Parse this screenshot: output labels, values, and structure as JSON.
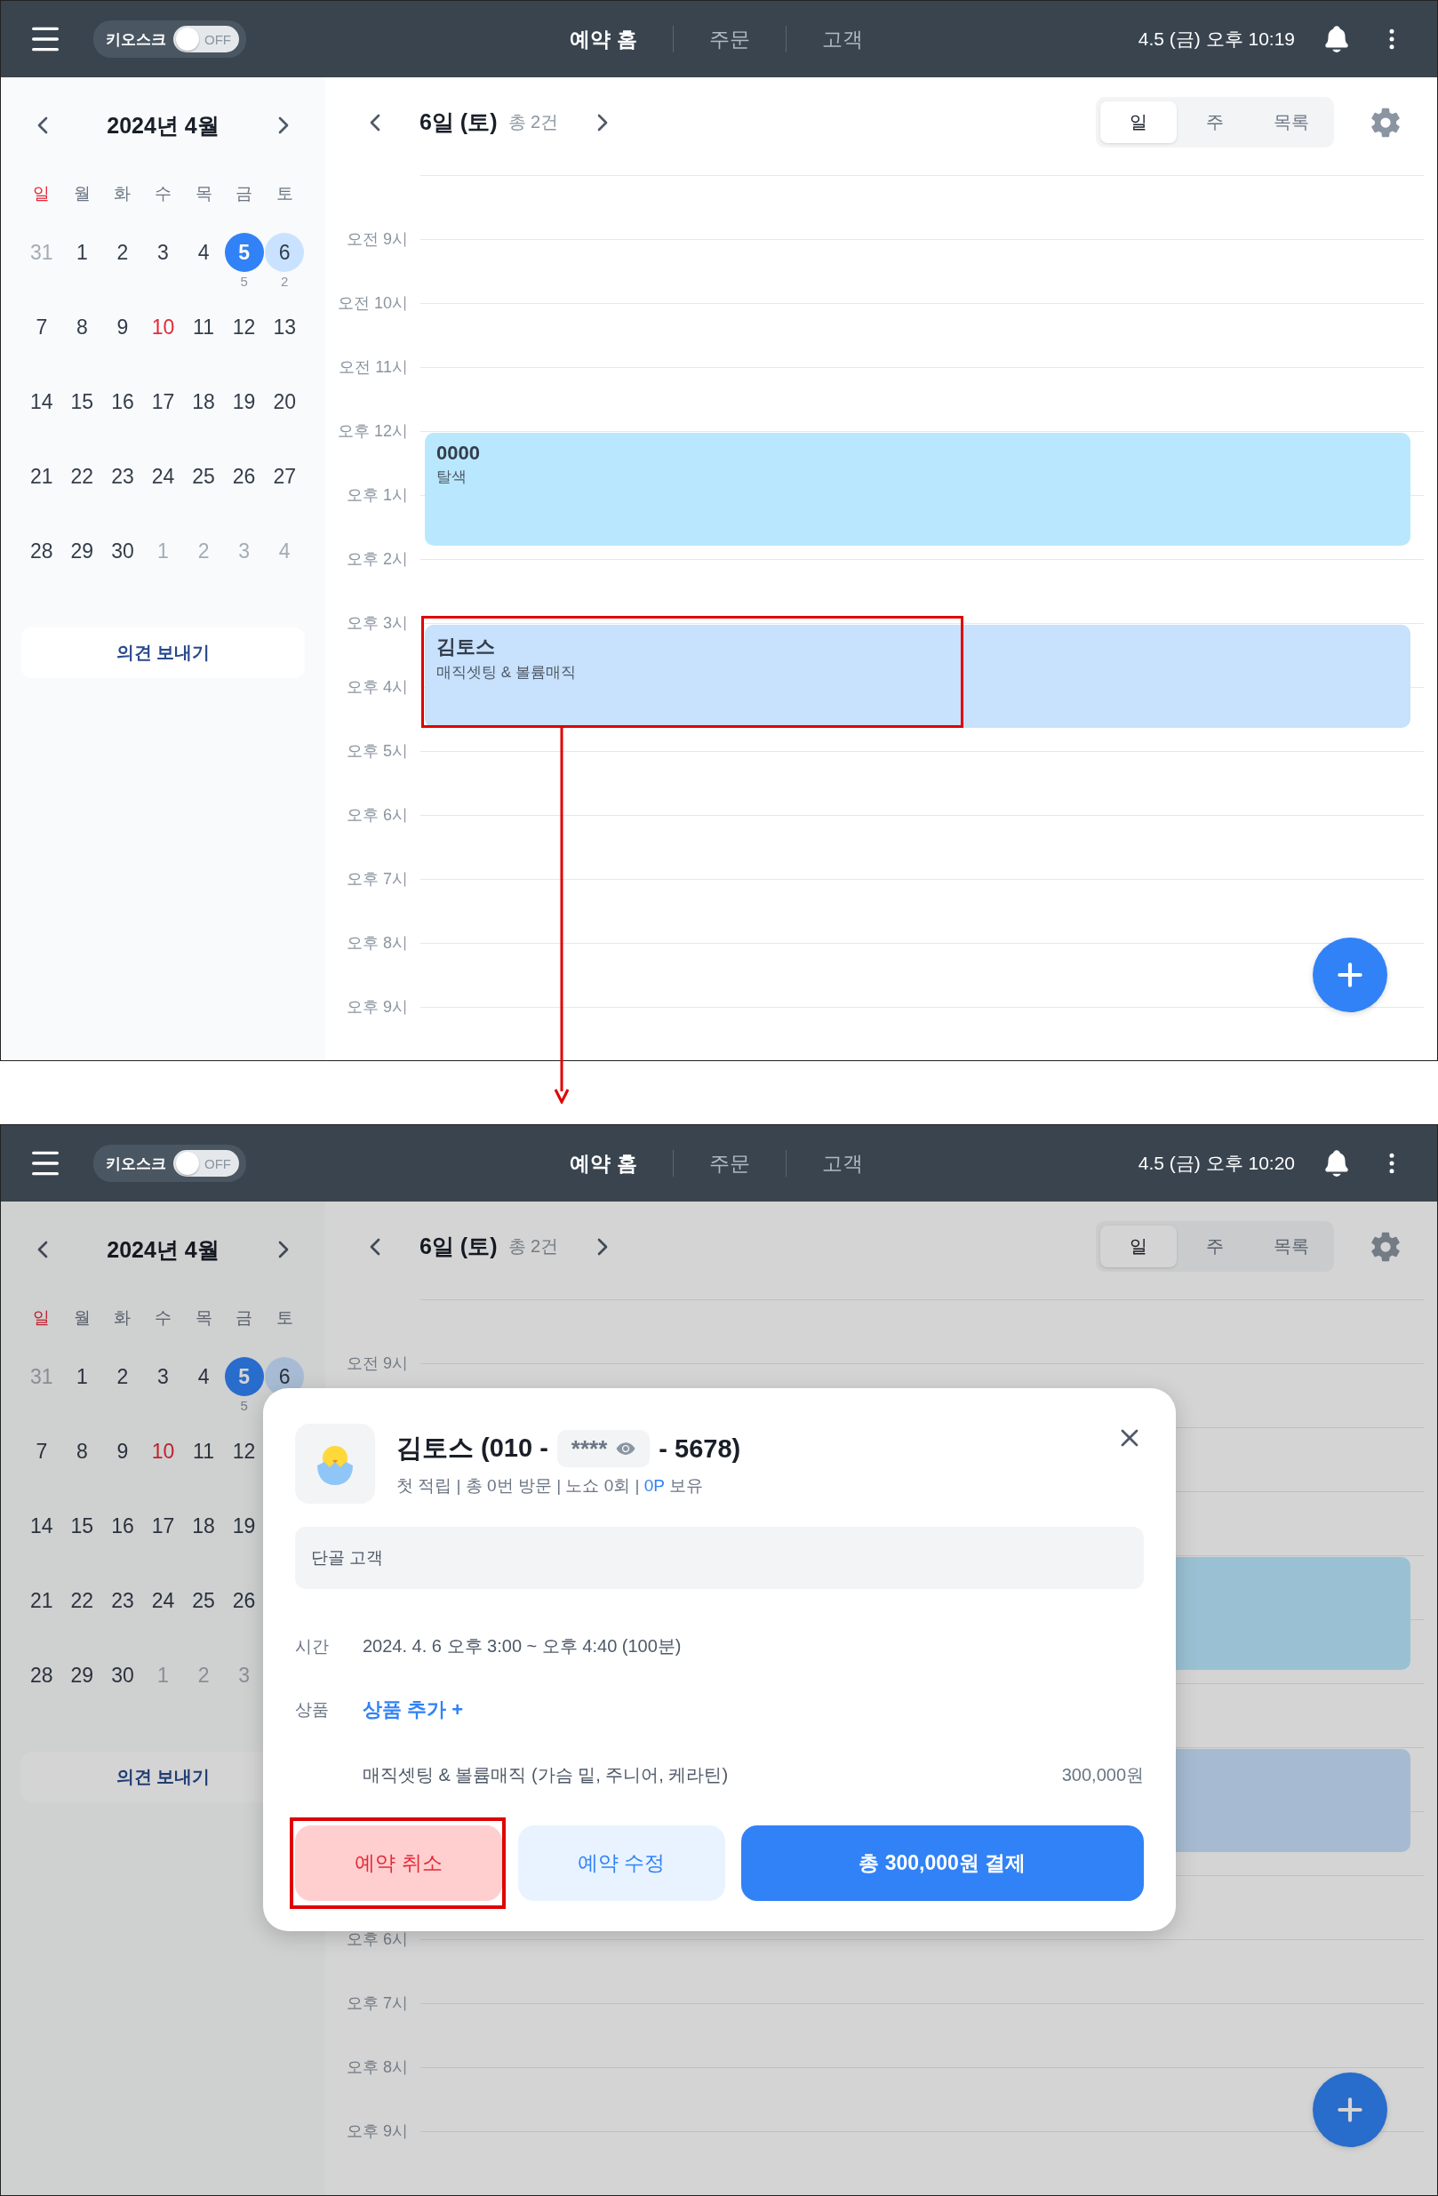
{
  "screens": [
    {
      "dimmed": false,
      "top_bar": {
        "kiosk": {
          "label": "키오스크",
          "on": false,
          "state_text": "OFF"
        },
        "nav": [
          {
            "label": "예약 홈",
            "selected": true
          },
          {
            "label": "주문",
            "selected": false
          },
          {
            "label": "고객",
            "selected": false
          }
        ],
        "clock": "4.5 (금) 오후 10:19"
      },
      "calendar": {
        "month": "2024년 4월",
        "weekdays": [
          {
            "label": "일",
            "holiday": true
          },
          {
            "label": "월",
            "holiday": false
          },
          {
            "label": "화",
            "holiday": false
          },
          {
            "label": "수",
            "holiday": false
          },
          {
            "label": "목",
            "holiday": false
          },
          {
            "label": "금",
            "holiday": false
          },
          {
            "label": "토",
            "holiday": false
          }
        ],
        "weeks": [
          [
            {
              "day": "31",
              "kind": "other"
            },
            {
              "day": "1",
              "kind": "normal"
            },
            {
              "day": "2",
              "kind": "normal"
            },
            {
              "day": "3",
              "kind": "normal"
            },
            {
              "day": "4",
              "kind": "normal"
            },
            {
              "day": "5",
              "kind": "today",
              "count": "5"
            },
            {
              "day": "6",
              "kind": "selected",
              "count": "2"
            }
          ],
          [
            {
              "day": "7",
              "kind": "normal"
            },
            {
              "day": "8",
              "kind": "normal"
            },
            {
              "day": "9",
              "kind": "normal"
            },
            {
              "day": "10",
              "kind": "holiday"
            },
            {
              "day": "11",
              "kind": "normal"
            },
            {
              "day": "12",
              "kind": "normal"
            },
            {
              "day": "13",
              "kind": "normal"
            }
          ],
          [
            {
              "day": "14",
              "kind": "normal"
            },
            {
              "day": "15",
              "kind": "normal"
            },
            {
              "day": "16",
              "kind": "normal"
            },
            {
              "day": "17",
              "kind": "normal"
            },
            {
              "day": "18",
              "kind": "normal"
            },
            {
              "day": "19",
              "kind": "normal"
            },
            {
              "day": "20",
              "kind": "normal"
            }
          ],
          [
            {
              "day": "21",
              "kind": "normal"
            },
            {
              "day": "22",
              "kind": "normal"
            },
            {
              "day": "23",
              "kind": "normal"
            },
            {
              "day": "24",
              "kind": "normal"
            },
            {
              "day": "25",
              "kind": "normal"
            },
            {
              "day": "26",
              "kind": "normal"
            },
            {
              "day": "27",
              "kind": "normal"
            }
          ],
          [
            {
              "day": "28",
              "kind": "normal"
            },
            {
              "day": "29",
              "kind": "normal"
            },
            {
              "day": "30",
              "kind": "normal"
            },
            {
              "day": "1",
              "kind": "other"
            },
            {
              "day": "2",
              "kind": "other"
            },
            {
              "day": "3",
              "kind": "other"
            },
            {
              "day": "4",
              "kind": "other"
            }
          ]
        ],
        "feedback_button": "의견 보내기"
      },
      "day_header": {
        "date": "6일 (토)",
        "total": "총 2건",
        "views": [
          {
            "label": "일",
            "selected": true
          },
          {
            "label": "주",
            "selected": false
          },
          {
            "label": "목록",
            "selected": false
          }
        ]
      },
      "timeline": {
        "rows": [
          {
            "label": "오전 9시"
          },
          {
            "label": "오전 10시"
          },
          {
            "label": "오전 11시"
          },
          {
            "label": "오후 12시"
          },
          {
            "label": "오후 1시"
          },
          {
            "label": "오후 2시"
          },
          {
            "label": "오후 3시"
          },
          {
            "label": "오후 4시"
          },
          {
            "label": "오후 5시"
          },
          {
            "label": "오후 6시"
          },
          {
            "label": "오후 7시"
          },
          {
            "label": "오후 8시"
          },
          {
            "label": "오후 9시"
          }
        ],
        "events": [
          {
            "title": "0000",
            "service": "탈색",
            "color": "#b9e8fe"
          },
          {
            "title": "김토스",
            "service": "매직셋팅 & 볼륨매직",
            "color": "#c8e1fc"
          }
        ]
      }
    },
    {
      "dimmed": true,
      "top_bar": {
        "kiosk": {
          "label": "키오스크",
          "on": false,
          "state_text": "OFF"
        },
        "nav": [
          {
            "label": "예약 홈",
            "selected": true
          },
          {
            "label": "주문",
            "selected": false
          },
          {
            "label": "고객",
            "selected": false
          }
        ],
        "clock": "4.5 (금) 오후 10:20"
      },
      "calendar": {
        "month": "2024년 4월",
        "weekdays": [
          {
            "label": "일",
            "holiday": true
          },
          {
            "label": "월",
            "holiday": false
          },
          {
            "label": "화",
            "holiday": false
          },
          {
            "label": "수",
            "holiday": false
          },
          {
            "label": "목",
            "holiday": false
          },
          {
            "label": "금",
            "holiday": false
          },
          {
            "label": "토",
            "holiday": false
          }
        ],
        "weeks": [
          [
            {
              "day": "31",
              "kind": "other"
            },
            {
              "day": "1",
              "kind": "normal"
            },
            {
              "day": "2",
              "kind": "normal"
            },
            {
              "day": "3",
              "kind": "normal"
            },
            {
              "day": "4",
              "kind": "normal"
            },
            {
              "day": "5",
              "kind": "today",
              "count": "5"
            },
            {
              "day": "6",
              "kind": "selected"
            }
          ],
          [
            {
              "day": "7",
              "kind": "normal"
            },
            {
              "day": "8",
              "kind": "normal"
            },
            {
              "day": "9",
              "kind": "normal"
            },
            {
              "day": "10",
              "kind": "holiday"
            },
            {
              "day": "11",
              "kind": "normal"
            },
            {
              "day": "12",
              "kind": "normal"
            }
          ],
          [
            {
              "day": "14",
              "kind": "normal"
            },
            {
              "day": "15",
              "kind": "normal"
            },
            {
              "day": "16",
              "kind": "normal"
            },
            {
              "day": "17",
              "kind": "normal"
            },
            {
              "day": "18",
              "kind": "normal"
            },
            {
              "day": "19",
              "kind": "normal"
            }
          ],
          [
            {
              "day": "21",
              "kind": "normal"
            },
            {
              "day": "22",
              "kind": "normal"
            },
            {
              "day": "23",
              "kind": "normal"
            },
            {
              "day": "24",
              "kind": "normal"
            },
            {
              "day": "25",
              "kind": "normal"
            },
            {
              "day": "26",
              "kind": "normal"
            }
          ],
          [
            {
              "day": "28",
              "kind": "normal"
            },
            {
              "day": "29",
              "kind": "normal"
            },
            {
              "day": "30",
              "kind": "normal"
            },
            {
              "day": "1",
              "kind": "other"
            },
            {
              "day": "2",
              "kind": "other"
            },
            {
              "day": "3",
              "kind": "other"
            }
          ]
        ],
        "feedback_button": "의견 보내기"
      },
      "day_header": {
        "date": "6일 (토)",
        "total": "총 2건",
        "views": [
          {
            "label": "일",
            "selected": true
          },
          {
            "label": "주",
            "selected": false
          },
          {
            "label": "목록",
            "selected": false
          }
        ]
      },
      "timeline": {
        "rows": [
          {
            "label": "오전 9시"
          },
          {},
          {},
          {},
          {},
          {},
          {},
          {},
          {},
          {
            "label": "오후 6시"
          },
          {
            "label": "오후 7시"
          },
          {
            "label": "오후 8시"
          },
          {
            "label": "오후 9시"
          }
        ],
        "events": [
          {
            "color": "#9ac1d3"
          },
          {
            "color": "#a6bbd1"
          }
        ]
      },
      "modal": {
        "name_prefix": "김토스 (010 -",
        "masked": "****",
        "name_suffix": "- 5678)",
        "stats": "첫 적립 | 총 0번 방문 | 노쇼 0회 |",
        "points": "0P",
        "points_suffix": "보유",
        "memo": "단골 고객",
        "time": {
          "label": "시간",
          "value": "2024. 4. 6 오후 3:00 ~ 오후 4:40 (100분)"
        },
        "product": {
          "label": "상품",
          "add_link": "상품 추가 +",
          "item": "매직셋팅 & 볼륨매직 (가슴 밑, 주니어, 케라틴)",
          "price": "300,000원"
        },
        "buttons": [
          {
            "label": "예약 취소",
            "kind": "cancel"
          },
          {
            "label": "예약 수정",
            "kind": "edit"
          },
          {
            "label": "총 300,000원 결제",
            "kind": "pay"
          }
        ]
      }
    }
  ]
}
